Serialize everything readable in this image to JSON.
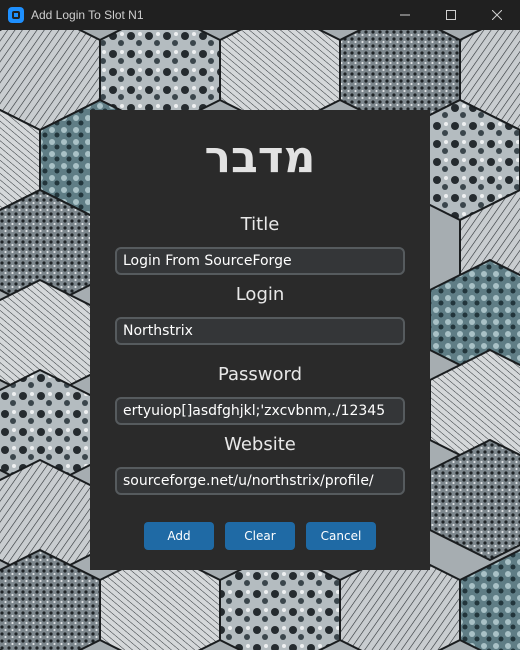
{
  "window": {
    "title": "Add Login To Slot N1",
    "icon": "app-icon",
    "controls": [
      "minimize-icon",
      "maximize-icon",
      "close-icon"
    ]
  },
  "dialog": {
    "heading": "מדבר",
    "fields": [
      {
        "label": "Title",
        "value": "Login From SourceForge"
      },
      {
        "label": "Login",
        "value": "Northstrix"
      },
      {
        "label": "Password",
        "value": "ertyuiop[]asdfghjkl;'zxcvbnm,./12345"
      },
      {
        "label": "Website",
        "value": "sourceforge.net/u/northstrix/profile/"
      }
    ],
    "buttons": {
      "add": "Add",
      "clear": "Clear",
      "cancel": "Cancel"
    }
  },
  "colors": {
    "titlebar": "#202020",
    "dialog_bg": "#2a2a2a",
    "input_bg": "#343638",
    "input_border": "#565b5e",
    "button": "#1f6aa5",
    "app_icon": "#1e90ff"
  }
}
